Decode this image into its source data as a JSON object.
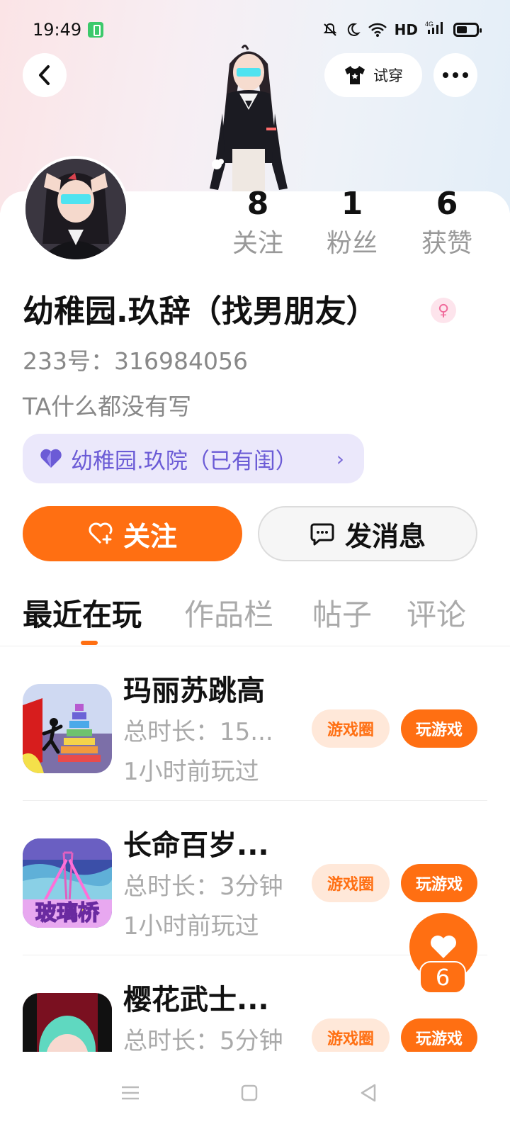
{
  "status_bar": {
    "time": "19:49",
    "network": "HD",
    "signal": "4G"
  },
  "header": {
    "try_on_label": "试穿"
  },
  "profile": {
    "stats": [
      {
        "value": "8",
        "label": "关注"
      },
      {
        "value": "1",
        "label": "粉丝"
      },
      {
        "value": "6",
        "label": "获赞"
      }
    ],
    "name": "幼稚园.玖辞（找男朋友）",
    "id_text": "233号：316984056",
    "bio": "TA什么都没有写",
    "family_chip": "幼稚园.玖院（已有闺）",
    "follow_label": "关注",
    "message_label": "发消息"
  },
  "tabs": [
    "最近在玩",
    "作品栏",
    "帖子",
    "评论"
  ],
  "games": [
    {
      "title": "玛丽苏跳高",
      "total_time": "总时长：15...",
      "last_played": "1小时前玩过",
      "circle_label": "游戏圈",
      "play_label": "玩游戏"
    },
    {
      "title": "长命百岁...",
      "total_time": "总时长：3分钟",
      "last_played": "1小时前玩过",
      "circle_label": "游戏圈",
      "play_label": "玩游戏",
      "thumb_text": "玻璃桥"
    },
    {
      "title": "樱花武士...",
      "total_time": "总时长：5分钟",
      "last_played": "",
      "circle_label": "游戏圈",
      "play_label": "玩游戏"
    }
  ],
  "like_fab": {
    "count": "6"
  },
  "colors": {
    "accent": "#ff6f12",
    "family_chip_bg": "#ebe8fb",
    "family_chip_text": "#6b5bd6"
  },
  "icons": [
    "back-arrow-icon",
    "shirt-icon",
    "more-dots-icon",
    "heart-icon",
    "chat-bubble-icon",
    "heart-plus-icon",
    "female-icon"
  ]
}
